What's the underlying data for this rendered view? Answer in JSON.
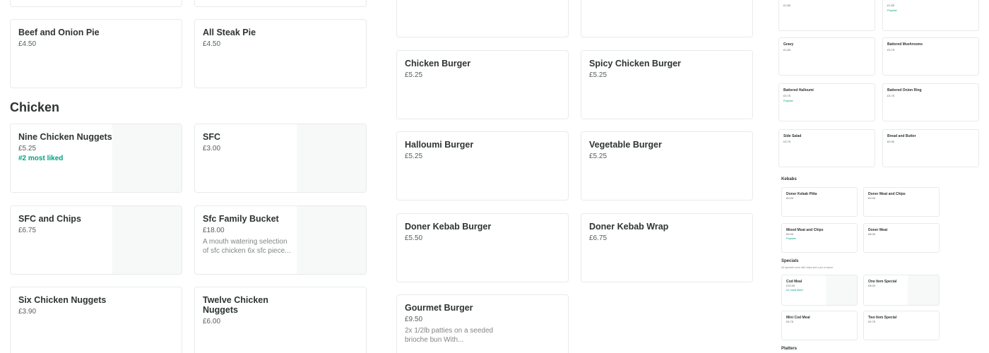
{
  "left_column": {
    "pies": [
      {
        "name": "Beef and Onion Pie",
        "price": "£4.50"
      },
      {
        "name": "All Steak Pie",
        "price": "£4.50"
      }
    ],
    "chicken_title": "Chicken",
    "chicken": [
      {
        "name": "Nine Chicken Nuggets",
        "price": "£5.25",
        "badge": "#2 most liked"
      },
      {
        "name": "SFC",
        "price": "£3.00"
      },
      {
        "name": "SFC and Chips",
        "price": "£6.75"
      },
      {
        "name": "Sfc Family Bucket",
        "price": "£18.00",
        "desc": "A mouth watering selection of sfc chicken 6x sfc piece..."
      },
      {
        "name": "Six Chicken Nuggets",
        "price": "£3.90"
      },
      {
        "name": "Twelve Chicken Nuggets",
        "price": "£6.00"
      }
    ]
  },
  "middle_column": {
    "burgers": [
      {
        "name": "Chicken Burger",
        "price": "£5.25"
      },
      {
        "name": "Spicy Chicken Burger",
        "price": "£5.25"
      },
      {
        "name": "Halloumi Burger",
        "price": "£5.25"
      },
      {
        "name": "Vegetable Burger",
        "price": "£5.25"
      },
      {
        "name": "Doner Kebab Burger",
        "price": "£5.50"
      },
      {
        "name": "Doner Kebab Wrap",
        "price": "£6.75"
      },
      {
        "name": "Gourmet Burger",
        "price": "£9.50",
        "desc": "2x 1/2lb patties on a seeded brioche bun With..."
      }
    ]
  },
  "right_column": {
    "top_prices": [
      {
        "price": "£1.80"
      },
      {
        "price": "£1.80",
        "badge": "Popular"
      }
    ],
    "sides": [
      {
        "name": "Gravy",
        "price": "£1.80"
      },
      {
        "name": "Battered Mushrooms",
        "price": "£3.75"
      },
      {
        "name": "Battered Halloumi",
        "price": "£3.75",
        "badge": "Popular"
      },
      {
        "name": "Battered Onion Ring",
        "price": "£3.75"
      },
      {
        "name": "Side Salad",
        "price": "£3.75"
      },
      {
        "name": "Bread and Butter",
        "price": "£0.90"
      }
    ],
    "kebabs_title": "Kebabs",
    "kebabs": [
      {
        "name": "Doner Kebab Pitta",
        "price": "£0.00"
      },
      {
        "name": "Doner Meat and Chips",
        "price": "£0.00"
      },
      {
        "name": "Mixed Meat and Chips",
        "price": "£0.00",
        "badge": "Popular"
      },
      {
        "name": "Doner Meat",
        "price": "£8.00"
      }
    ],
    "specials_title": "Specials",
    "specials_subtitle": "All specials come with chips and a pot of sauce",
    "specials": [
      {
        "name": "Cod Meal",
        "price": "£10.00",
        "badge": "#1 most liked"
      },
      {
        "name": "One Item Special",
        "price": "£8.00"
      },
      {
        "name": "Mini Cod Meal",
        "price": "£9.75"
      },
      {
        "name": "Two Item Special",
        "price": "£9.75"
      }
    ],
    "platters_title": "Platters"
  },
  "colors": {
    "accent": "#00a082",
    "text": "#2e3333",
    "border": "#e8ebeb",
    "image_placeholder": "#f7f8f8"
  }
}
